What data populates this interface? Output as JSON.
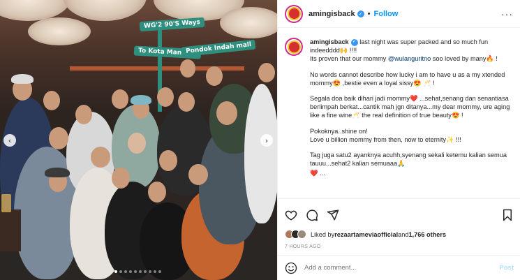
{
  "post": {
    "username": "amingisback",
    "follow_label": "Follow",
    "separator": "•",
    "more_label": "···"
  },
  "photo": {
    "signs": [
      "WG'2 90'S Ways",
      "To Kota Mangkal",
      "Pondok Indah mall"
    ],
    "slide_count": 10,
    "active_slide": 1
  },
  "caption": {
    "username": "amingisback",
    "p1_a": " last night was super packed and so much fun indeedddd🙌 !!!!",
    "p1_b": "Its proven that our mommy ",
    "p1_mention": "@wulanguritno",
    "p1_c": " soo loved by many🔥 !",
    "p2": "No words cannot describe how lucky i am to have u as a my xtended mommy😍 ,bestie even a loyal sissy😍 🥂 !",
    "p3": "Segala doa baik dihari jadi mommy❤️ ...sehat,senang dan senantiasa berlimpah berkat...cantik mah jgn ditanya...my dear mommy, ure aging like a fine wine🥂 the real definition of true beauty😍 !",
    "p4": "Pokoknya..shine on!\nLove u billion mommy from then, now to eternity✨ !!!",
    "p5": "Tag juga satu2 ayanknya acuhh,syenang sekali ketemu kalian semua tauuu...sehat2 kalian semuaaa🙏",
    "p6": "❤️ ..."
  },
  "actions": {
    "liked_by_label": "Liked by ",
    "liked_by_user": "rezaartameviaofficial",
    "and_label": " and ",
    "others": "1,766 others",
    "timestamp": "7 HOURS AGO"
  },
  "comment": {
    "placeholder": "Add a comment...",
    "post_label": "Post"
  },
  "colors": {
    "accent": "#0095f6",
    "verified": "#3897f0",
    "post_disabled": "#b2dffc"
  }
}
